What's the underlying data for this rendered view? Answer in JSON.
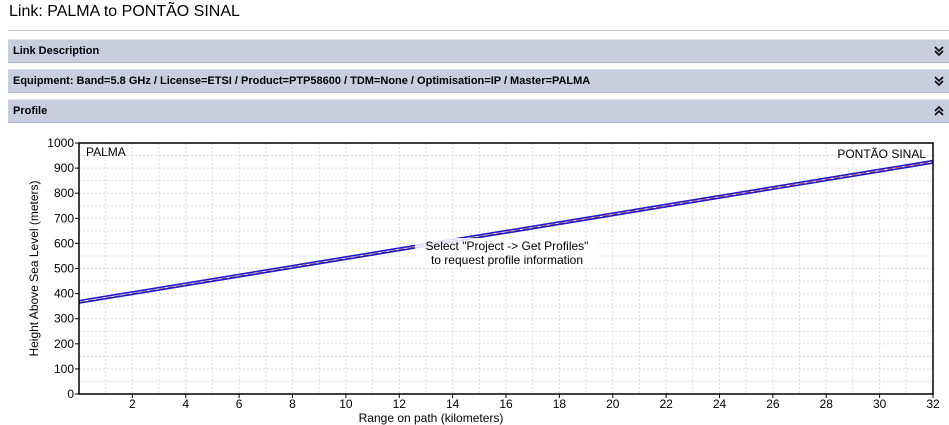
{
  "page": {
    "title": "Link: PALMA to PONTÃO SINAL"
  },
  "panels": [
    {
      "label": "Link Description",
      "state": "collapsed",
      "icon": "chevron-double-down-icon"
    },
    {
      "label": "Equipment: Band=5.8 GHz / License=ETSI / Product=PTP58600 / TDM=None / Optimisation=IP / Master=PALMA",
      "state": "collapsed",
      "icon": "chevron-double-down-icon"
    },
    {
      "label": "Profile",
      "state": "expanded",
      "icon": "chevron-double-up-icon"
    }
  ],
  "colors": {
    "header_bg": "#c8cde0",
    "fresnel_line": "#1a1acc",
    "los_line": "#e04848",
    "grid": "#dcdcdc"
  },
  "chart_data": {
    "type": "line",
    "title": "",
    "xlabel": "Range on path (kilometers)",
    "ylabel": "Height Above Sea Level (meters)",
    "xlim": [
      0,
      32
    ],
    "ylim": [
      0,
      1000
    ],
    "xticks": [
      2,
      4,
      6,
      8,
      10,
      12,
      14,
      16,
      18,
      20,
      22,
      24,
      26,
      28,
      30,
      32
    ],
    "yticks": [
      0,
      100,
      200,
      300,
      400,
      500,
      600,
      700,
      800,
      900,
      1000
    ],
    "grid": true,
    "left_site": "PALMA",
    "right_site": "PONTÃO SINAL",
    "message_line1": "Select \"Project -> Get Profiles\"",
    "message_line2": "to request profile information",
    "series": [
      {
        "role": "fresnel-upper",
        "x": [
          0,
          32
        ],
        "y": [
          372,
          930
        ]
      },
      {
        "role": "line-of-sight",
        "x": [
          0,
          32
        ],
        "y": [
          365,
          925
        ]
      },
      {
        "role": "fresnel-lower",
        "x": [
          0,
          32
        ],
        "y": [
          362,
          920
        ]
      }
    ]
  }
}
